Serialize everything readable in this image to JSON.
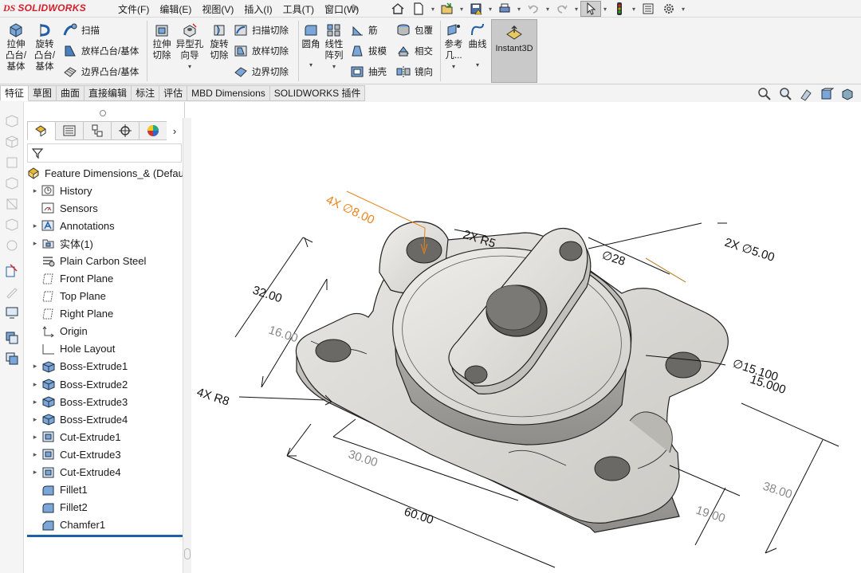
{
  "app": {
    "logo_ds": "DS",
    "logo_text": "SOLIDWORKS"
  },
  "menu": {
    "items": [
      "文件(F)",
      "编辑(E)",
      "视图(V)",
      "插入(I)",
      "工具(T)",
      "窗口(W)"
    ]
  },
  "quick_access": [
    "home-icon",
    "new-doc-icon",
    "open-icon",
    "save-icon",
    "print-icon",
    "undo-icon",
    "redo-icon",
    "select-icon",
    "traffic-light-icon",
    "options-list-icon",
    "settings-gear-icon"
  ],
  "commands": {
    "extrude_boss": "拉伸\n凸台/\n基体",
    "revolve_boss": "旋转\n凸台/\n基体",
    "sweep": "扫描",
    "loft": "放样凸台/基体",
    "boundary": "边界凸台/基体",
    "extrude_cut": "拉伸\n切除",
    "hole_wizard": "异型孔\n向导",
    "revolve_cut": "旋转\n切除",
    "swept_cut": "扫描切除",
    "lofted_cut": "放样切除",
    "boundary_cut": "边界切除",
    "fillet": "圆角",
    "linear_pattern": "线性\n阵列",
    "rib": "筋",
    "draft": "拔模",
    "shell": "抽壳",
    "wrap": "包覆",
    "intersect": "相交",
    "mirror": "镜向",
    "reference_geometry": "参考\n几...",
    "curves": "曲线",
    "instant3d": "Instant3D"
  },
  "tabs": [
    "特征",
    "草图",
    "曲面",
    "直接编辑",
    "标注",
    "评估",
    "MBD Dimensions",
    "SOLIDWORKS 插件"
  ],
  "feature_manager": {
    "tab_icons": [
      "feature-tree-icon",
      "property-manager-icon",
      "configuration-icon",
      "dimxpert-icon",
      "appearance-icon"
    ],
    "root_label": "Feature Dimensions_& (Defau",
    "items": [
      {
        "label": "History",
        "icon": "history-icon",
        "expandable": true
      },
      {
        "label": "Sensors",
        "icon": "sensors-icon",
        "expandable": false
      },
      {
        "label": "Annotations",
        "icon": "annotations-icon",
        "expandable": true
      },
      {
        "label": "实体(1)",
        "icon": "solid-bodies-icon",
        "expandable": true
      },
      {
        "label": "Plain Carbon Steel",
        "icon": "material-icon",
        "expandable": false
      },
      {
        "label": "Front Plane",
        "icon": "plane-icon",
        "expandable": false
      },
      {
        "label": "Top Plane",
        "icon": "plane-icon",
        "expandable": false
      },
      {
        "label": "Right Plane",
        "icon": "plane-icon",
        "expandable": false
      },
      {
        "label": "Origin",
        "icon": "origin-icon",
        "expandable": false
      },
      {
        "label": "Hole Layout",
        "icon": "sketch-icon",
        "expandable": false
      },
      {
        "label": "Boss-Extrude1",
        "icon": "boss-extrude-icon",
        "expandable": true
      },
      {
        "label": "Boss-Extrude2",
        "icon": "boss-extrude-icon",
        "expandable": true
      },
      {
        "label": "Boss-Extrude3",
        "icon": "boss-extrude-icon",
        "expandable": true
      },
      {
        "label": "Boss-Extrude4",
        "icon": "boss-extrude-icon",
        "expandable": true
      },
      {
        "label": "Cut-Extrude1",
        "icon": "cut-extrude-icon",
        "expandable": true
      },
      {
        "label": "Cut-Extrude3",
        "icon": "cut-extrude-icon",
        "expandable": true
      },
      {
        "label": "Cut-Extrude4",
        "icon": "cut-extrude-icon",
        "expandable": true
      },
      {
        "label": "Fillet1",
        "icon": "fillet-icon",
        "expandable": false
      },
      {
        "label": "Fillet2",
        "icon": "fillet-icon",
        "expandable": false
      },
      {
        "label": "Chamfer1",
        "icon": "chamfer-icon",
        "expandable": false
      }
    ]
  },
  "dimensions": {
    "hole_8": "4X ∅8.00",
    "r5": "2X R5",
    "d5": "2X ∅5.00",
    "d28": "∅28",
    "d32": "32.00",
    "d16": "16.00",
    "r8": "4X R8",
    "tol_upper": "∅15.100",
    "tol_lower": "15.000",
    "d30": "30.00",
    "d60": "60.00",
    "d38": "38.00",
    "d19": "19.00"
  },
  "colors": {
    "accent": "#1f5ea8",
    "selected_dim": "#e8821a",
    "logo": "#d4202b",
    "part": "#d6d4cf"
  }
}
